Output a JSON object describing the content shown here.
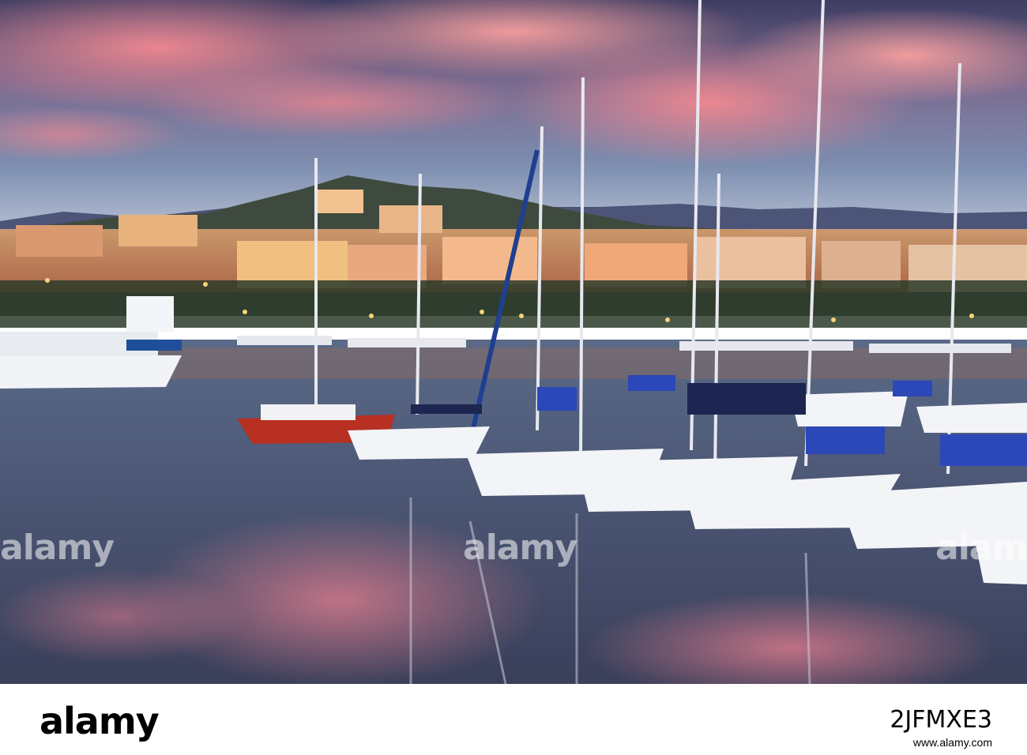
{
  "photo": {
    "subject": "harbour"
  },
  "watermark": {
    "text": "alamy",
    "mark": "a"
  },
  "footer": {
    "logo": "alamy",
    "image_id": "2JFMXE3",
    "url": "www.alamy.com"
  },
  "colors": {
    "sky_top": "#3b3a5c",
    "sky_pink": "#e97a8a",
    "water": "#4a4f6a",
    "footer_bg": "#ffffff"
  }
}
